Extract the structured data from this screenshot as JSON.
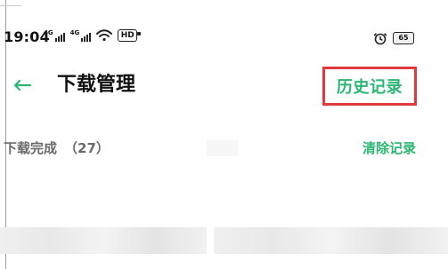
{
  "status": {
    "time": "19:04",
    "net1": "4G",
    "net2": "4G",
    "hd": "HD",
    "battery": "65"
  },
  "header": {
    "title": "下载管理",
    "history": "历史记录"
  },
  "section": {
    "label": "下载完成",
    "count": "（27）",
    "clear": "清除记录"
  },
  "colors": {
    "accent": "#2bb673",
    "highlight": "#e0393e"
  },
  "icons": {
    "back": "back-arrow-icon",
    "wifi": "wifi-icon",
    "alarm": "alarm-clock-icon",
    "battery": "battery-icon",
    "signal": "cellular-signal-icon"
  }
}
